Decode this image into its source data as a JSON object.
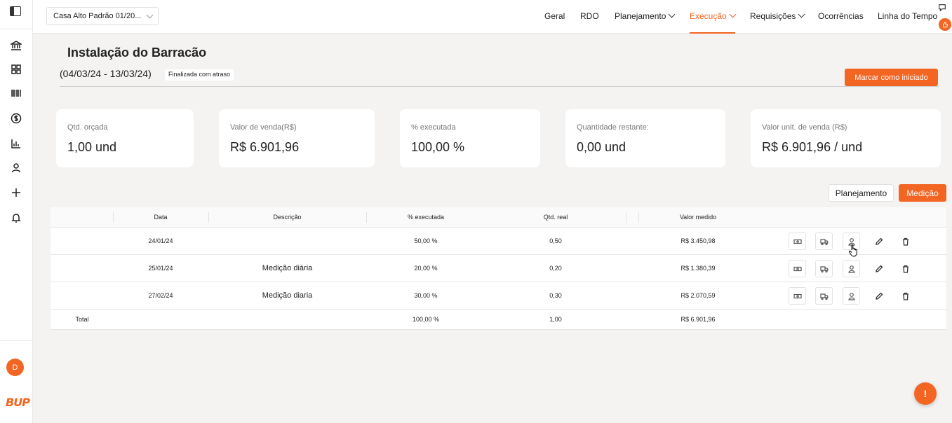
{
  "topbar": {
    "project": "Casa Alto Padrão 01/20...",
    "nav": [
      {
        "label": "Geral",
        "dropdown": false,
        "active": false
      },
      {
        "label": "RDO",
        "dropdown": false,
        "active": false
      },
      {
        "label": "Planejamento",
        "dropdown": true,
        "active": false
      },
      {
        "label": "Execução",
        "dropdown": true,
        "active": true
      },
      {
        "label": "Requisições",
        "dropdown": true,
        "active": false
      },
      {
        "label": "Ocorrências",
        "dropdown": false,
        "active": false
      },
      {
        "label": "Linha do Tempo",
        "dropdown": false,
        "active": false
      }
    ]
  },
  "sidebar": {
    "icons": [
      "bank-icon",
      "grid-icon",
      "barcode-icon",
      "dollar-icon",
      "chart-icon",
      "user-icon",
      "plus-icon",
      "bell-icon"
    ],
    "avatar": "D",
    "logo": "BUP"
  },
  "header": {
    "title": "Instalação do Barracão",
    "date_range": "(04/03/24 - 13/03/24)",
    "status": "Finalizada com atraso",
    "action_label": "Marcar como iniciado"
  },
  "cards": [
    {
      "label": "Qtd. orçada",
      "value": "1,00 und"
    },
    {
      "label": "Valor de venda(R$)",
      "value": "R$ 6.901,96"
    },
    {
      "label": "% executada",
      "value": "100,00 %"
    },
    {
      "label": "Quantidade restante:",
      "value": "0,00 und"
    },
    {
      "label": "Valor unit. de venda (R$)",
      "value": "R$ 6.901,96 / und"
    }
  ],
  "tabs": {
    "planejamento": "Planejamento",
    "medicao": "Medição"
  },
  "table": {
    "headers": {
      "data": "Data",
      "descricao": "Descrição",
      "executada": "% executada",
      "qtd_real": "Qtd. real",
      "valor_medido": "Valor medido"
    },
    "rows": [
      {
        "data": "24/01/24",
        "descricao": "",
        "executada": "50,00 %",
        "qtd_real": "0,50",
        "valor_medido": "R$ 3.450,98"
      },
      {
        "data": "25/01/24",
        "descricao": "Medição diária",
        "executada": "20,00 %",
        "qtd_real": "0,20",
        "valor_medido": "R$ 1.380,39"
      },
      {
        "data": "27/02/24",
        "descricao": "Medição diaria",
        "executada": "30,00 %",
        "qtd_real": "0,30",
        "valor_medido": "R$ 2.070,59"
      }
    ],
    "total": {
      "label": "Total",
      "executada": "100,00 %",
      "qtd_real": "1,00",
      "valor_medido": "R$ 6.901,96"
    }
  },
  "fab_label": "!",
  "colors": {
    "accent": "#f26522",
    "background": "#f4f3f2"
  }
}
